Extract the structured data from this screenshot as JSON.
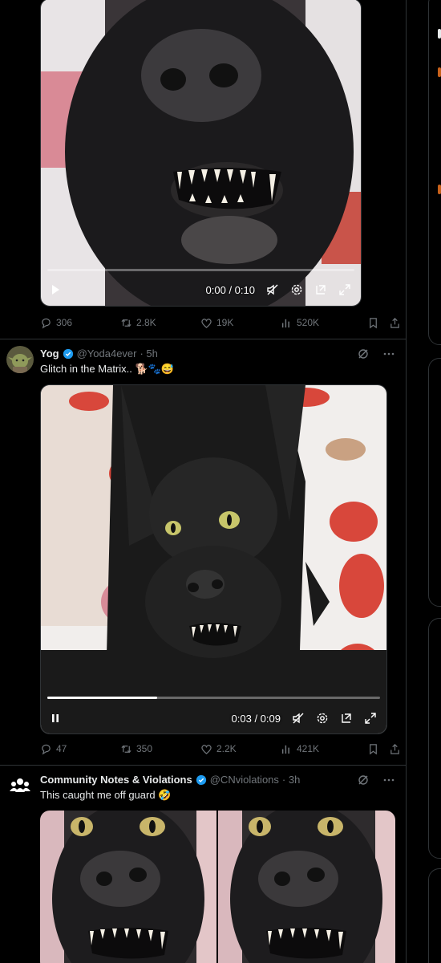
{
  "posts": [
    {
      "stats": {
        "replies": "306",
        "reposts": "2.8K",
        "likes": "19K",
        "views": "520K"
      },
      "video": {
        "time": "0:00 / 0:10",
        "progress": 0.0,
        "state": "paused"
      }
    },
    {
      "author": {
        "name": "Yog",
        "handle": "@Yoda4ever",
        "time": "· 5h"
      },
      "text": "Glitch in the Matrix.. 🐕🐾😅",
      "stats": {
        "replies": "47",
        "reposts": "350",
        "likes": "2.2K",
        "views": "421K"
      },
      "video": {
        "time": "0:03 / 0:09",
        "progress": 0.33,
        "state": "playing"
      }
    },
    {
      "author": {
        "name": "Community Notes & Violations",
        "handle": "@CNviolations",
        "time": "· 3h"
      },
      "text": "This caught me off guard 🤣"
    }
  ],
  "icons": {
    "reply": "reply-icon",
    "repost": "repost-icon",
    "like": "heart-icon",
    "views": "views-icon",
    "bookmark": "bookmark-icon",
    "share": "share-icon",
    "grok": "grok-icon",
    "more": "more-icon",
    "play": "play-icon",
    "pause": "pause-icon",
    "mute": "mute-icon",
    "settings": "settings-icon",
    "pip": "pip-icon",
    "fullscreen": "fullscreen-icon"
  },
  "colors": {
    "background": "#000000",
    "border": "#2f3336",
    "secondary_text": "#71767b",
    "verified": "#1d9bf0",
    "primary_text": "#e7e9ea"
  }
}
